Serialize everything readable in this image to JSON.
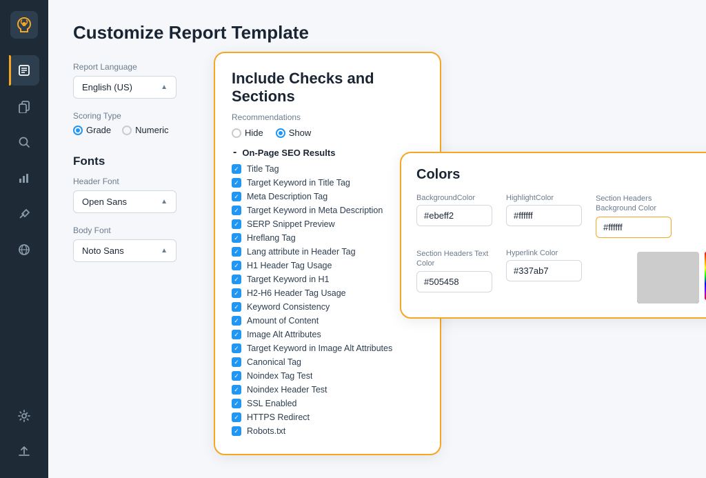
{
  "app": {
    "title": "Customize Report Template"
  },
  "sidebar": {
    "items": [
      {
        "id": "logo",
        "icon": "⟳",
        "label": "Logo"
      },
      {
        "id": "edit",
        "icon": "✏",
        "label": "Edit",
        "active": true
      },
      {
        "id": "copy",
        "icon": "❐",
        "label": "Copy"
      },
      {
        "id": "search",
        "icon": "⌕",
        "label": "Search"
      },
      {
        "id": "chart",
        "icon": "▦",
        "label": "Chart"
      },
      {
        "id": "tool",
        "icon": "⚒",
        "label": "Tool"
      },
      {
        "id": "globe",
        "icon": "⊕",
        "label": "Globe"
      }
    ],
    "bottom_items": [
      {
        "id": "settings",
        "icon": "⚙",
        "label": "Settings"
      },
      {
        "id": "upload",
        "icon": "↑",
        "label": "Upload"
      }
    ]
  },
  "left_panel": {
    "report_language_label": "Report Language",
    "report_language_value": "English (US)",
    "scoring_type_label": "Scoring Type",
    "scoring_options": [
      {
        "label": "Grade",
        "checked": true
      },
      {
        "label": "Numeric",
        "checked": false
      }
    ],
    "fonts_title": "Fonts",
    "header_font_label": "Header Font",
    "header_font_value": "Open Sans",
    "body_font_label": "Body Font",
    "body_font_value": "Noto Sans"
  },
  "checks_panel": {
    "title": "Include Checks and Sections",
    "recommendations_label": "Recommendations",
    "hide_label": "Hide",
    "show_label": "Show",
    "section_name": "On-Page SEO Results",
    "checklist": [
      "Title Tag",
      "Target Keyword in Title Tag",
      "Meta Description Tag",
      "Target Keyword in Meta Description",
      "SERP Snippet Preview",
      "Hreflang Tag",
      "Lang attribute in Header Tag",
      "H1 Header Tag Usage",
      "Target Keyword in H1",
      "H2-H6 Header Tag Usage",
      "Keyword Consistency",
      "Amount of Content",
      "Image Alt Attributes",
      "Target Keyword in Image Alt Attributes",
      "Canonical Tag",
      "Noindex Tag Test",
      "Noindex Header Test",
      "SSL Enabled",
      "HTTPS Redirect",
      "Robots.txt"
    ]
  },
  "colors_panel": {
    "title": "Colors",
    "fields": [
      {
        "label": "BackgroundColor",
        "value": "#ebeff2"
      },
      {
        "label": "HighlightColor",
        "value": "#ffffff"
      },
      {
        "label": "Section Headers Background Color",
        "value": "#ffffff",
        "active": true
      },
      {
        "label": "Section Headers Text Color",
        "value": "#505458"
      },
      {
        "label": "Hyperlink Color",
        "value": "#337ab7"
      }
    ]
  }
}
